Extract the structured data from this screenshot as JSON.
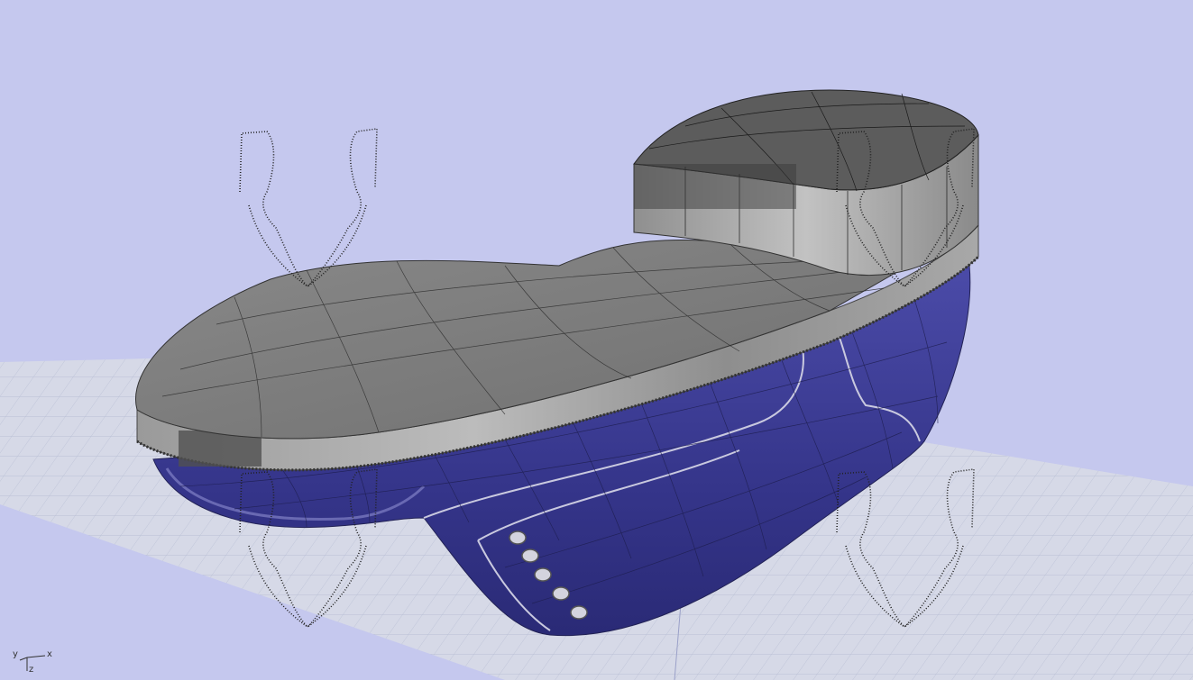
{
  "viewport": {
    "background_color": "#c5c8ee",
    "ground_plane_color": "#d4d8e6",
    "ground_grid_color": "#b6bdd3",
    "model": {
      "sole_color": "#8f8f8f",
      "sole_top_color": "#7c7c7c",
      "heel_color": "#5f5f5f",
      "upper_color": "#3f3f98",
      "eyelet_color": "#d4d4de",
      "eyelet_count": 5
    },
    "section_curves_count": 4,
    "axis_triad": {
      "x": "x",
      "y": "y",
      "z": "z",
      "icon": "axis-triad-icon"
    }
  }
}
